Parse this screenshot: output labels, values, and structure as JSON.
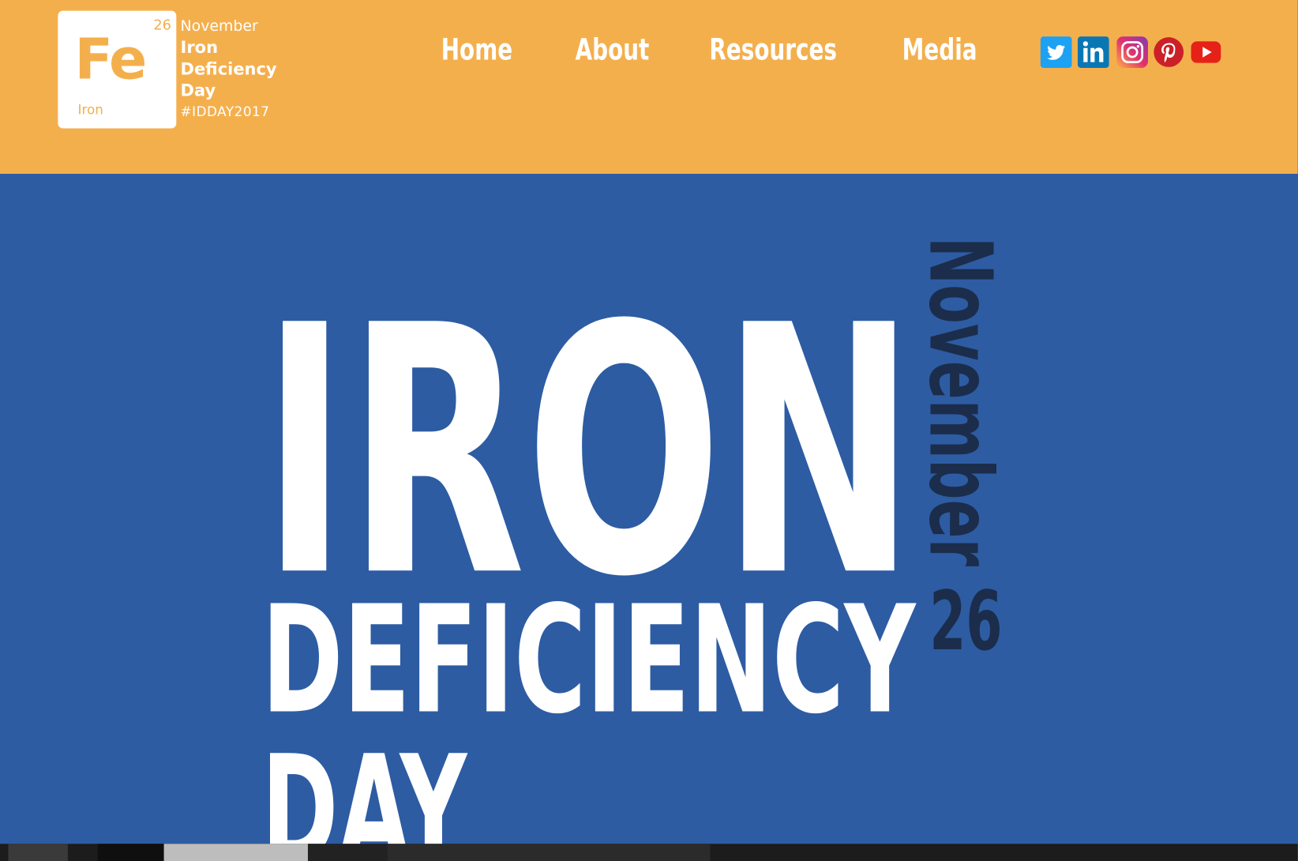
{
  "colors": {
    "header_bg": "#f4af4d",
    "hero_bg": "#2d5ca3",
    "hero_text": "#ffffff",
    "hero_accent": "#1b2d4b",
    "logo_accent": "#f4af4d"
  },
  "logo": {
    "atomic_number": "26",
    "symbol": "Fe",
    "element": "Iron",
    "month": "November",
    "line1": "Iron",
    "line2": "Deficiency",
    "line3": "Day",
    "hashtag": "#IDDAY2017"
  },
  "nav": {
    "items": [
      {
        "label": "Home"
      },
      {
        "label": "About"
      },
      {
        "label": "Resources"
      },
      {
        "label": "Media"
      }
    ]
  },
  "social": [
    {
      "name": "twitter-icon",
      "color": "#1da1f2"
    },
    {
      "name": "linkedin-icon",
      "color": "#0a77b5"
    },
    {
      "name": "instagram-icon",
      "color": "#c13584"
    },
    {
      "name": "pinterest-icon",
      "color": "#cb2027"
    },
    {
      "name": "youtube-icon",
      "color": "#e62117"
    }
  ],
  "hero": {
    "line1": "IRON",
    "line2": "DEFICIENCY",
    "line3": "DAY",
    "vertical_text": "November",
    "day": "26"
  }
}
